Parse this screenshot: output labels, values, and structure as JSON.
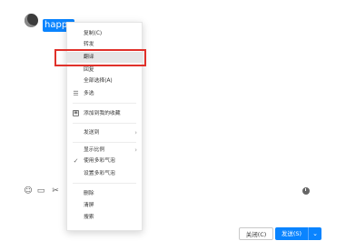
{
  "chat": {
    "message_text": "happy"
  },
  "context_menu": {
    "copy": "复制(C)",
    "forward": "转发",
    "translate": "翻译",
    "reply": "回复",
    "select_all": "全部选择(A)",
    "multi_select": "多选",
    "add_to_favorites": "添加到我的收藏",
    "send_to": "发送到",
    "display_ratio": "显示比例",
    "use_color_bubble": "使用多彩气泡",
    "set_color_bubble": "设置多彩气泡",
    "delete": "删除",
    "clear": "清屏",
    "search": "搜索",
    "submenu_arrow": "›",
    "check_mark": "✓",
    "favorite_icon": "▣",
    "multiselect_icon": "☰"
  },
  "footer": {
    "close_label": "关闭(C)",
    "send_label": "发送(S)",
    "dropdown_arrow": "⌄"
  },
  "colors": {
    "accent": "#0a84ff",
    "highlight_box": "#e0312a"
  }
}
